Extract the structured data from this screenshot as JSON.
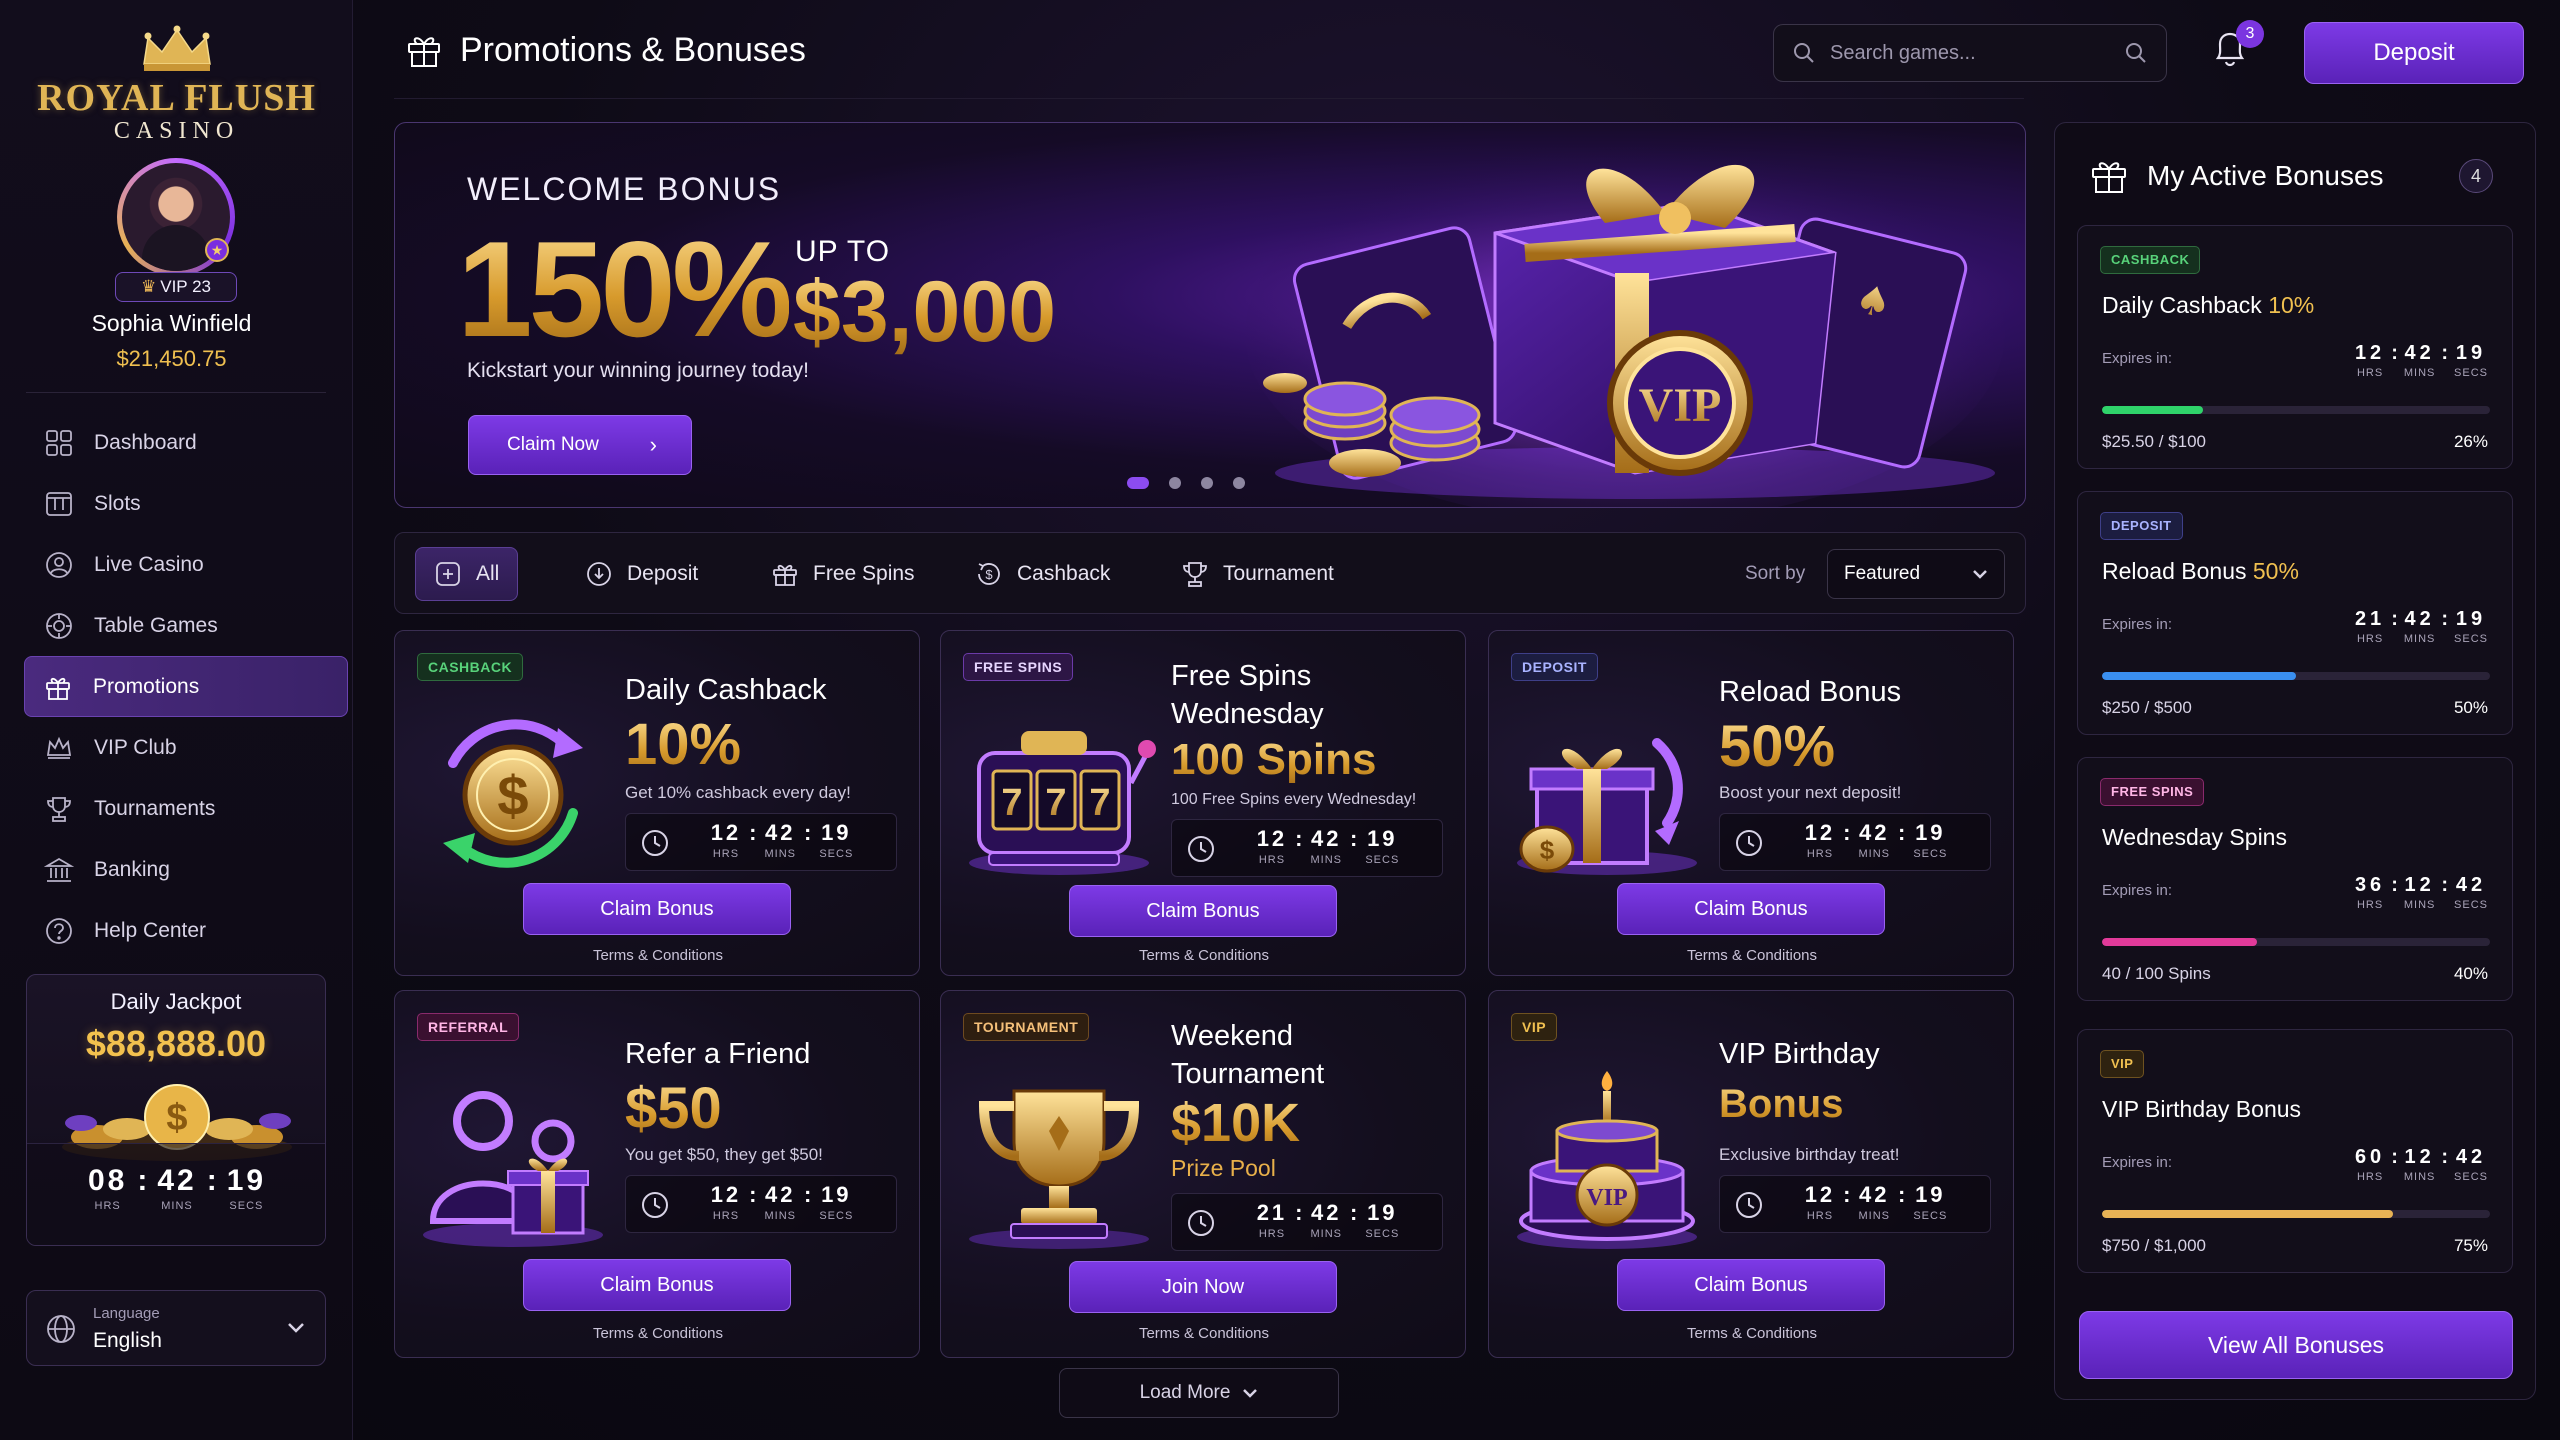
{
  "brand": {
    "name": "ROYAL FLUSH",
    "subtitle": "CASINO"
  },
  "user": {
    "vip_label": "VIP 23",
    "name": "Sophia Winfield",
    "balance": "$21,450.75"
  },
  "nav": [
    {
      "label": "Dashboard",
      "icon": "dashboard-icon"
    },
    {
      "label": "Slots",
      "icon": "slots-icon"
    },
    {
      "label": "Live Casino",
      "icon": "live-casino-icon"
    },
    {
      "label": "Table Games",
      "icon": "table-games-icon"
    },
    {
      "label": "Promotions",
      "icon": "gift-icon",
      "active": true
    },
    {
      "label": "VIP Club",
      "icon": "crown-icon"
    },
    {
      "label": "Tournaments",
      "icon": "trophy-icon"
    },
    {
      "label": "Banking",
      "icon": "bank-icon"
    },
    {
      "label": "Help Center",
      "icon": "help-icon"
    }
  ],
  "jackpot": {
    "title": "Daily Jackpot",
    "amount": "$88,888.00",
    "hrs": "08",
    "mins": "42",
    "secs": "19",
    "hrs_label": "HRS",
    "mins_label": "MINS",
    "secs_label": "SECS"
  },
  "language": {
    "label": "Language",
    "value": "English"
  },
  "header": {
    "title": "Promotions & Bonuses",
    "search_placeholder": "Search games...",
    "notifications": "3",
    "deposit": "Deposit"
  },
  "hero": {
    "eyebrow": "WELCOME BONUS",
    "percent": "150%",
    "up_to": "UP TO",
    "amount": "$3,000",
    "subtitle": "Kickstart your winning journey today!",
    "cta": "Claim Now",
    "slides": 4,
    "active_slide": 0,
    "badge": "VIP"
  },
  "filters": {
    "chips": [
      {
        "label": "All",
        "icon": "grid-plus-icon",
        "active": true
      },
      {
        "label": "Deposit",
        "icon": "deposit-icon"
      },
      {
        "label": "Free Spins",
        "icon": "gift-icon"
      },
      {
        "label": "Cashback",
        "icon": "cashback-icon"
      },
      {
        "label": "Tournament",
        "icon": "trophy-icon"
      }
    ],
    "sort_label": "Sort by",
    "sort_value": "Featured"
  },
  "cards": [
    {
      "tag": "CASHBACK",
      "title": "Daily Cashback",
      "big": "10%",
      "desc": "Get 10% cashback every day!",
      "hrs": "12",
      "mins": "42",
      "secs": "19",
      "cta": "Claim Bonus",
      "terms": "Terms & Conditions"
    },
    {
      "tag": "FREE SPINS",
      "title": "Free Spins Wednesday",
      "big": "100 Spins",
      "desc": "100 Free Spins every Wednesday!",
      "hrs": "12",
      "mins": "42",
      "secs": "19",
      "cta": "Claim Bonus",
      "terms": "Terms & Conditions"
    },
    {
      "tag": "DEPOSIT",
      "title": "Reload Bonus",
      "big": "50%",
      "desc": "Boost your next deposit!",
      "hrs": "12",
      "mins": "42",
      "secs": "19",
      "cta": "Claim Bonus",
      "terms": "Terms & Conditions"
    },
    {
      "tag": "REFERRAL",
      "title": "Refer a Friend",
      "big": "$50",
      "desc": "You get $50, they get $50!",
      "hrs": "12",
      "mins": "42",
      "secs": "19",
      "cta": "Claim Bonus",
      "terms": "Terms & Conditions"
    },
    {
      "tag": "TOURNAMENT",
      "title": "Weekend Tournament",
      "big": "$10K",
      "desc": "Prize Pool",
      "hrs": "21",
      "mins": "42",
      "secs": "19",
      "cta": "Join Now",
      "terms": "Terms & Conditions"
    },
    {
      "tag": "VIP",
      "title": "VIP Birthday",
      "big": "Bonus",
      "desc": "Exclusive birthday treat!",
      "hrs": "12",
      "mins": "42",
      "secs": "19",
      "cta": "Claim Bonus",
      "terms": "Terms & Conditions",
      "art_label": "VIP"
    }
  ],
  "load_more": "Load More",
  "active_bonuses": {
    "title": "My Active Bonuses",
    "count": "4",
    "expires_label": "Expires in:",
    "items": [
      {
        "tag": "CASHBACK",
        "name": "Daily Cashback",
        "highlight": "10%",
        "hrs": "12",
        "mins": "42",
        "secs": "19",
        "progress": "$25.50 / $100",
        "pct": "26%",
        "fill": 0.26,
        "color": "#2fd36a"
      },
      {
        "tag": "DEPOSIT",
        "name": "Reload Bonus",
        "highlight": "50%",
        "hrs": "21",
        "mins": "42",
        "secs": "19",
        "progress": "$250 / $500",
        "pct": "50%",
        "fill": 0.5,
        "color": "#3a8ff0"
      },
      {
        "tag": "FREE SPINS",
        "name": "Wednesday Spins",
        "highlight": "",
        "hrs": "36",
        "mins": "12",
        "secs": "42",
        "progress": "40 / 100 Spins",
        "pct": "40%",
        "fill": 0.4,
        "color": "#e23a9a"
      },
      {
        "tag": "VIP",
        "name": "VIP Birthday Bonus",
        "highlight": "",
        "hrs": "60",
        "mins": "12",
        "secs": "42",
        "progress": "$750 / $1,000",
        "pct": "75%",
        "fill": 0.75,
        "color": "#e7b255"
      }
    ],
    "view_all": "View All Bonuses"
  },
  "timer_labels": {
    "hrs": "HRS",
    "mins": "MINS",
    "secs": "SECS"
  }
}
